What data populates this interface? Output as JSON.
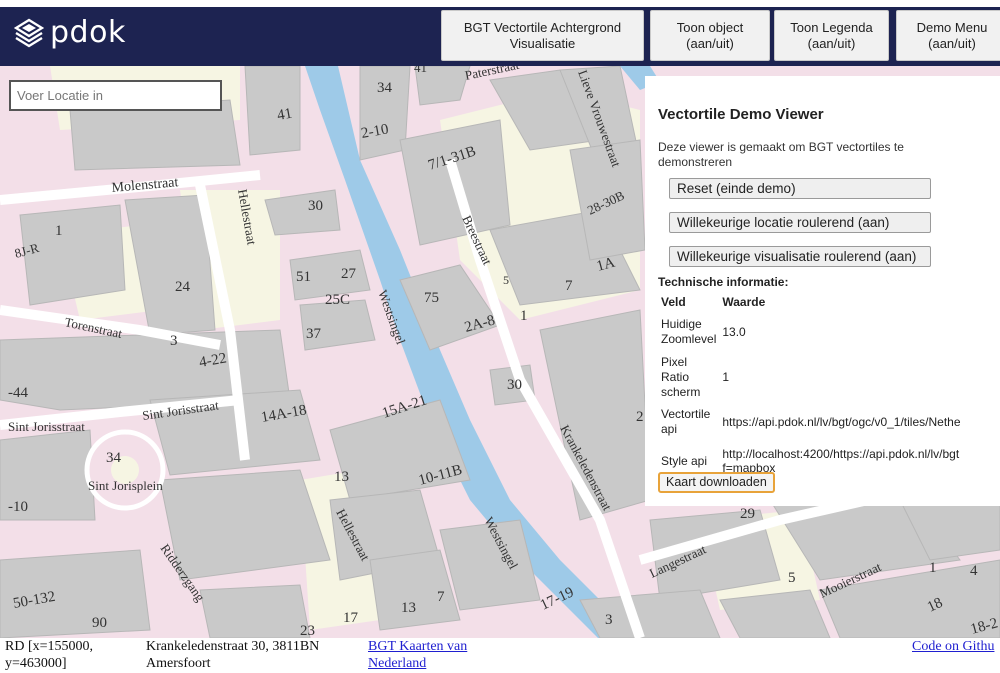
{
  "header": {
    "logo_text": "pdok",
    "buttons": [
      {
        "label": "BGT Vectortile Achtergrond Visualisatie"
      },
      {
        "label": "Toon object (aan/uit)"
      },
      {
        "label": "Toon Legenda (aan/uit)"
      },
      {
        "label": "Demo Menu (aan/uit)"
      }
    ]
  },
  "search": {
    "placeholder": "Voer Locatie in"
  },
  "map": {
    "streets": [
      "Molenstraat",
      "Hellestraat",
      "Westsingel",
      "Breestraat",
      "Torenstraat",
      "Sint Jorisstraat",
      "Sint Jorisplein",
      "Ridderzgang",
      "Krankeledenstraat",
      "Langestraat",
      "Mooierstraat",
      "Lieve Vrouwestraat",
      "Paterstraat"
    ],
    "house_numbers": [
      "34",
      "41",
      "2-10",
      "7/1-31B",
      "28-30B",
      "30",
      "1",
      "8J-R",
      "24",
      "3",
      "4-22",
      "51",
      "27",
      "25C",
      "37",
      "75",
      "2A-8",
      "5",
      "7",
      "1A",
      "1",
      "30",
      "14A-18",
      "15A-21",
      "-44",
      "34",
      "13",
      "10-11B",
      "-10",
      "50-132",
      "90",
      "17",
      "13",
      "7",
      "23",
      "17-19",
      "3",
      "5",
      "1",
      "4",
      "18",
      "18-2",
      "29",
      "2",
      "41",
      "5"
    ]
  },
  "panel": {
    "title": "Vectortile Demo Viewer",
    "description": "Deze viewer is gemaakt om BGT vectortiles te demonstreren",
    "buttons": [
      {
        "label": "Reset (einde demo)"
      },
      {
        "label": "Willekeurige locatie roulerend (aan)"
      },
      {
        "label": "Willekeurige visualisatie roulerend (aan)"
      }
    ],
    "tech_title": "Technische informatie:",
    "table_headers": [
      "Veld",
      "Waarde"
    ],
    "rows": [
      {
        "field": "Huidige Zoomlevel",
        "value": "13.0"
      },
      {
        "field": "Pixel Ratio scherm",
        "value": "1"
      },
      {
        "field": "Vectortile api",
        "value": "https://api.pdok.nl/lv/bgt/ogc/v0_1/tiles/Nethe"
      },
      {
        "field": "Style api",
        "value": "http://localhost:4200/https://api.pdok.nl/lv/bgt f=mapbox"
      }
    ],
    "download_label": "Kaart downloaden"
  },
  "footer": {
    "coords": "RD [x=155000, y=463000]",
    "address": "Krankeledenstraat 30, 3811BN Amersfoort",
    "link_bgt": "BGT Kaarten van Nederland",
    "link_code": "Code on Githu"
  },
  "colors": {
    "header_bg": "#1d2351",
    "water": "#9ecae8",
    "building": "#c9c9c9",
    "road": "#f3dfe8",
    "yard": "#f6f5e3",
    "download_border": "#e8a33a"
  }
}
